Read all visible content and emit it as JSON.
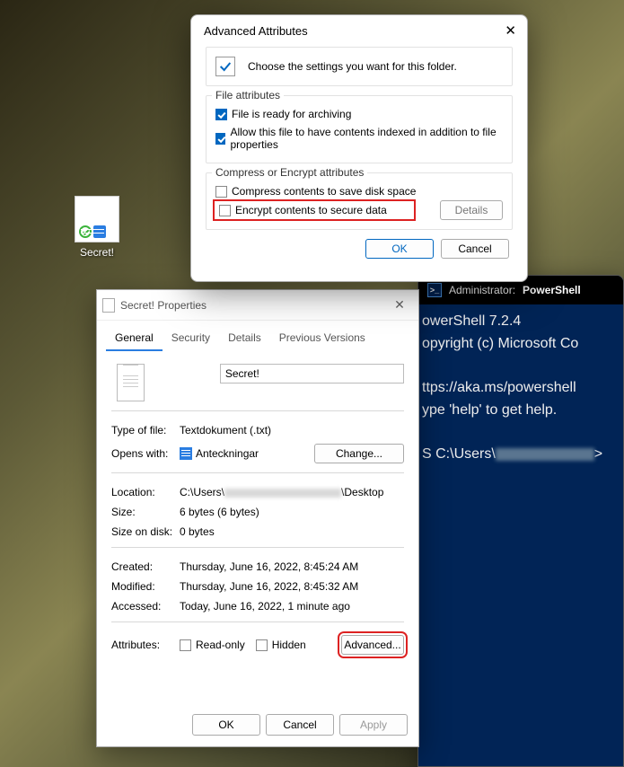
{
  "desktop": {
    "file_label": "Secret!"
  },
  "powershell": {
    "title_prefix": "Administrator:",
    "title_app": "PowerShell",
    "line1_a": "owerShell 7.2.4",
    "line2_a": "opyright (c) Microsoft Co",
    "line3_a": "ttps://aka.ms/powershell",
    "line4_a": "ype 'help' to get help.",
    "prompt_a": "S C:\\Users\\",
    "prompt_b": ">"
  },
  "props": {
    "title": "Secret! Properties",
    "tabs": {
      "general": "General",
      "security": "Security",
      "details": "Details",
      "previous": "Previous Versions"
    },
    "filename": "Secret!",
    "type_label": "Type of file:",
    "type_value": "Textdokument (.txt)",
    "opens_label": "Opens with:",
    "opens_value": "Anteckningar",
    "change": "Change...",
    "location_label": "Location:",
    "location_prefix": "C:\\Users\\",
    "location_suffix": "\\Desktop",
    "size_label": "Size:",
    "size_value": "6 bytes (6 bytes)",
    "sod_label": "Size on disk:",
    "sod_value": "0 bytes",
    "created_label": "Created:",
    "created_value": "Thursday, June 16, 2022, 8:45:24 AM",
    "modified_label": "Modified:",
    "modified_value": "Thursday, June 16, 2022, 8:45:32 AM",
    "accessed_label": "Accessed:",
    "accessed_value": "Today, June 16, 2022, 1 minute ago",
    "attr_label": "Attributes:",
    "readonly": "Read-only",
    "hidden": "Hidden",
    "advanced": "Advanced...",
    "ok": "OK",
    "cancel": "Cancel",
    "apply": "Apply"
  },
  "adv": {
    "title": "Advanced Attributes",
    "intro": "Choose the settings you want for this folder.",
    "group1_legend": "File attributes",
    "archiving": "File is ready for archiving",
    "indexing": "Allow this file to have contents indexed in addition to file properties",
    "group2_legend": "Compress or Encrypt attributes",
    "compress": "Compress contents to save disk space",
    "encrypt": "Encrypt contents to secure data",
    "details": "Details",
    "ok": "OK",
    "cancel": "Cancel"
  }
}
